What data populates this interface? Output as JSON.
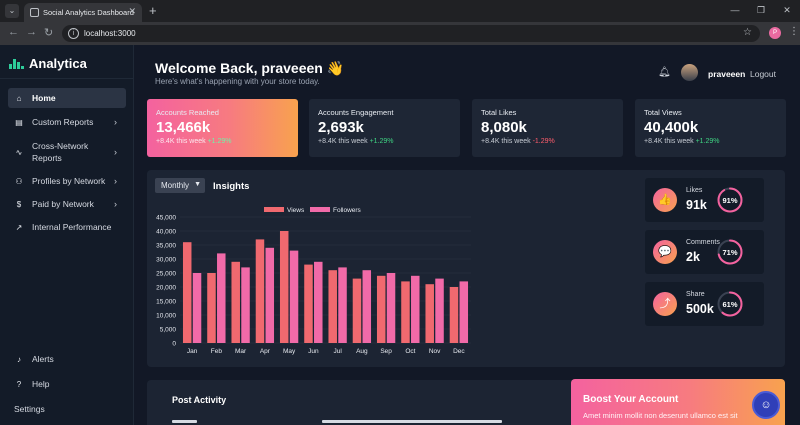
{
  "browser": {
    "tab_title": "Social Analytics Dashboard",
    "url": "localhost:3000",
    "profile_initial": "P"
  },
  "sidebar": {
    "brand": "Analytica",
    "items": [
      {
        "label": "Home",
        "icon": "home-icon",
        "glyph": "⌂",
        "active": true,
        "chevron": false
      },
      {
        "label": "Custom Reports",
        "icon": "document-icon",
        "glyph": "▤",
        "active": false,
        "chevron": true
      },
      {
        "label": "Cross-Network Reports",
        "icon": "chart-icon",
        "glyph": "∿",
        "active": false,
        "chevron": true
      },
      {
        "label": "Profiles by Network",
        "icon": "users-icon",
        "glyph": "⚇",
        "active": false,
        "chevron": true
      },
      {
        "label": "Paid by Network",
        "icon": "dollar-icon",
        "glyph": "$",
        "active": false,
        "chevron": true
      },
      {
        "label": "Internal Performance",
        "icon": "trend-icon",
        "glyph": "↗",
        "active": false,
        "chevron": false
      }
    ],
    "bottom": [
      {
        "label": "Alerts",
        "icon": "bell-icon",
        "glyph": "♪"
      },
      {
        "label": "Help",
        "icon": "help-icon",
        "glyph": "?"
      },
      {
        "label": "Settings",
        "icon": "",
        "glyph": ""
      }
    ]
  },
  "header": {
    "welcome": "Welcome Back, praveeen 👋",
    "subtitle": "Here's what's happening with your store today.",
    "username": "praveeen",
    "logout": "Logout"
  },
  "stats": [
    {
      "label": "Accounts Reached",
      "value": "13,466k",
      "sub": "+8.4K this week",
      "change": "+1.29%",
      "trend": "up"
    },
    {
      "label": "Accounts Engagement",
      "value": "2,693k",
      "sub": "+8.4K this week",
      "change": "+1.29%",
      "trend": "up"
    },
    {
      "label": "Total Likes",
      "value": "8,080k",
      "sub": "+8.4K this week",
      "change": "-1.29%",
      "trend": "down"
    },
    {
      "label": "Total Views",
      "value": "40,400k",
      "sub": "+8.4K this week",
      "change": "+1.29%",
      "trend": "up"
    }
  ],
  "insights": {
    "period": "Monthly",
    "title": "Insights"
  },
  "metrics": [
    {
      "label": "Likes",
      "value": "91k",
      "percent": 91,
      "percent_label": "91%",
      "icon": "thumbs-up-icon",
      "glyph": "👍"
    },
    {
      "label": "Comments",
      "value": "2k",
      "percent": 71,
      "percent_label": "71%",
      "icon": "comment-icon",
      "glyph": "💬"
    },
    {
      "label": "Share",
      "value": "500k",
      "percent": 61,
      "percent_label": "61%",
      "icon": "share-icon",
      "glyph": "⤴"
    }
  ],
  "chart_data": {
    "type": "bar",
    "categories": [
      "Jan",
      "Feb",
      "Mar",
      "Apr",
      "May",
      "Jun",
      "Jul",
      "Aug",
      "Sep",
      "Oct",
      "Nov",
      "Dec"
    ],
    "series": [
      {
        "name": "Views",
        "color": "#f0696f",
        "values": [
          36000,
          25000,
          29000,
          37000,
          40000,
          28000,
          26000,
          23000,
          24000,
          22000,
          21000,
          20000
        ]
      },
      {
        "name": "Followers",
        "color": "#f16aa8",
        "values": [
          25000,
          32000,
          27000,
          34000,
          33000,
          29000,
          27000,
          26000,
          25000,
          24000,
          23000,
          22000
        ]
      }
    ],
    "ylim": [
      0,
      45000
    ],
    "yticks": [
      "0",
      "5,000",
      "10,000",
      "15,000",
      "20,000",
      "25,000",
      "30,000",
      "35,000",
      "40,000",
      "45,000"
    ],
    "legend": "top-center",
    "grid": true
  },
  "bottom": {
    "post_activity": "Post Activity",
    "boost_title": "Boost Your Account",
    "boost_text": "Amet minim mollit non deserunt ullamco est sit"
  }
}
